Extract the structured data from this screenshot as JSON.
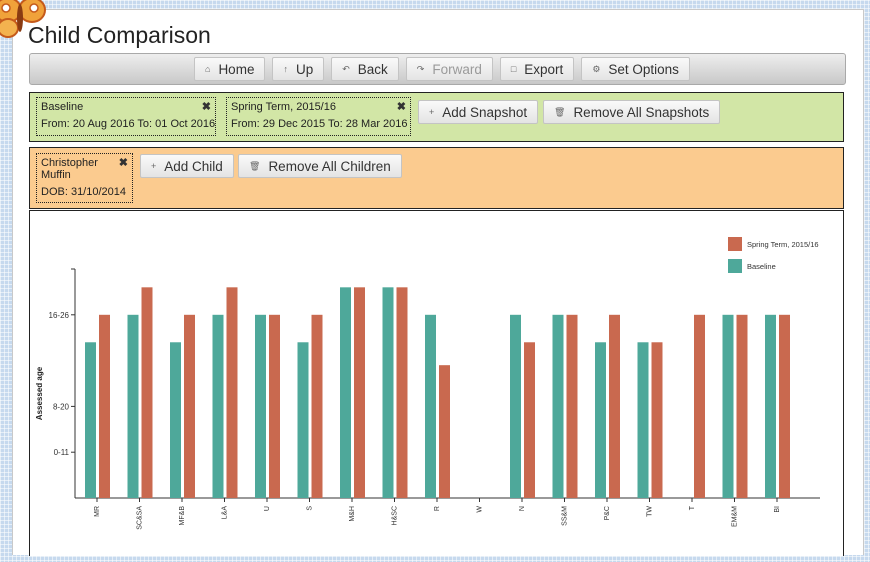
{
  "page": {
    "title": "Child Comparison"
  },
  "toolbar": {
    "buttons": [
      {
        "label": "Home",
        "icon": "home-icon",
        "glyph": "⌂",
        "enabled": true
      },
      {
        "label": "Up",
        "icon": "arrow-up-icon",
        "glyph": "↑",
        "enabled": true
      },
      {
        "label": "Back",
        "icon": "back-arrow-icon",
        "glyph": "↶",
        "enabled": true
      },
      {
        "label": "Forward",
        "icon": "forward-arrow-icon",
        "glyph": "↷",
        "enabled": false
      },
      {
        "label": "Export",
        "icon": "document-icon",
        "glyph": "□",
        "enabled": true
      },
      {
        "label": "Set Options",
        "icon": "gear-icon",
        "glyph": "⚙",
        "enabled": true
      }
    ]
  },
  "snapshots": {
    "items": [
      {
        "name": "Baseline",
        "dates": "From: 20 Aug 2016  To: 01 Oct 2016"
      },
      {
        "name": "Spring Term, 2015/16",
        "dates": "From: 29 Dec 2015  To: 28 Mar 2016"
      }
    ],
    "add_label": "Add Snapshot",
    "remove_label": "Remove All Snapshots"
  },
  "children": {
    "items": [
      {
        "name": "Christopher Muffin",
        "dob": "DOB: 31/10/2014"
      }
    ],
    "add_label": "Add Child",
    "remove_label": "Remove All Children"
  },
  "chart_data": {
    "type": "bar",
    "ylabel": "Assessed age",
    "y_ticks": [
      {
        "label": "0-11",
        "level": 1
      },
      {
        "label": "8-20",
        "level": 2
      },
      {
        "label": "16-26",
        "level": 4
      }
    ],
    "ylim": [
      0,
      5
    ],
    "categories": [
      "MR",
      "SC&SA",
      "MF&B",
      "L&A",
      "U",
      "S",
      "M&H",
      "H&SC",
      "R",
      "W",
      "N",
      "SS&M",
      "P&C",
      "TW",
      "T",
      "EM&M",
      "BI"
    ],
    "series": [
      {
        "name": "Baseline",
        "color": "#4ea89a",
        "values": [
          3.4,
          4,
          3.4,
          4,
          4,
          3.4,
          4.6,
          4.6,
          4,
          null,
          4,
          4,
          3.4,
          3.4,
          null,
          4,
          4
        ]
      },
      {
        "name": "Spring Term, 2015/16",
        "color": "#c9694f",
        "values": [
          4,
          4.6,
          4,
          4.6,
          4,
          4,
          4.6,
          4.6,
          2.9,
          null,
          3.4,
          4,
          4,
          3.4,
          4,
          4,
          4
        ]
      }
    ],
    "legend": {
      "position": "top-right",
      "order": [
        "Spring Term, 2015/16",
        "Baseline"
      ]
    }
  }
}
